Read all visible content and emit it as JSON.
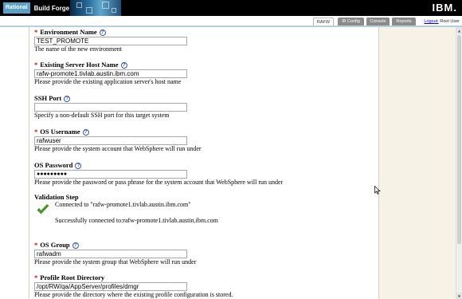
{
  "banner": {
    "brand_rational": "Rational",
    "brand_product": "Build Forge",
    "ibm_logo": "IBM."
  },
  "tabs": [
    {
      "label": "RAFW",
      "active": true
    },
    {
      "label": "IB Config",
      "active": false
    },
    {
      "label": "Console",
      "active": false
    },
    {
      "label": "Reports",
      "active": false
    }
  ],
  "session": {
    "logout_label": "Logout:",
    "user": "Root User"
  },
  "form": {
    "environment_name": {
      "label": "Environment Name",
      "value": "TEST_PROMOTE",
      "description": "The name of the new environment"
    },
    "server_host": {
      "label": "Existing Server Host Name",
      "value": "rafw-promote1.tivlab.austin.ibm.com",
      "description": "Please provide the existing application server's host name"
    },
    "ssh_port": {
      "label": "SSH Port",
      "value": "",
      "description": "Specify a non-default SSH port for this target system"
    },
    "os_username": {
      "label": "OS Username",
      "value": "rafwuser",
      "description": "Please provide the system account that WebSphere will run under"
    },
    "os_password": {
      "label": "OS Password",
      "value": "●●●●●●●●●",
      "description": "Please provide the password or pass phrase for the system account that WebSphere will run under"
    },
    "validation": {
      "label": "Validation Step",
      "connected_msg": "Connected to \"rafw-promote1.tivlab.austin.ibm.com\"",
      "success_msg": "Successfully connected to:rafw-promote1.tivlab.austin.ibm.com"
    },
    "os_group": {
      "label": "OS Group",
      "value": "rafwadm",
      "description": "Please provide the system group that WebSphere will run under"
    },
    "profile_root": {
      "label": "Profile Root Directory",
      "value": "/opt/RW/qa/AppServer/profiles/dmgr",
      "description": "Please provide the directory where the existing profile configuration is stored."
    }
  },
  "colors": {
    "required": "#cc0000",
    "help_icon": "#3355aa",
    "banner": "#000000",
    "side_panel": "#f6f3e6",
    "check": "#4aa02c"
  }
}
